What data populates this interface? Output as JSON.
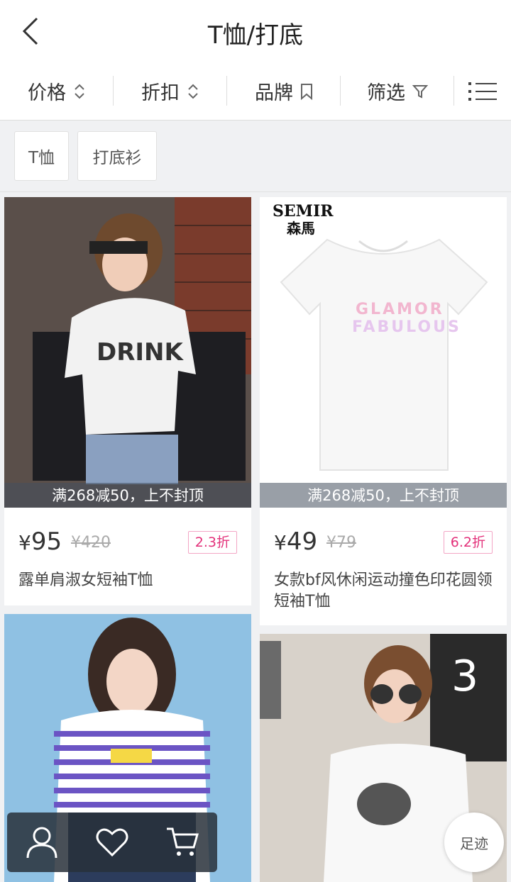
{
  "header": {
    "title": "T恤/打底"
  },
  "filters": [
    {
      "label": "价格",
      "icon": "sort-updown-icon"
    },
    {
      "label": "折扣",
      "icon": "sort-updown-icon"
    },
    {
      "label": "品牌",
      "icon": "bookmark-icon"
    },
    {
      "label": "筛选",
      "icon": "filter-funnel-icon"
    }
  ],
  "tags": [
    "T恤",
    "打底衫"
  ],
  "products": [
    {
      "promo": "满268减50，上不封顶",
      "currency": "¥",
      "price": "95",
      "old_price": "¥420",
      "discount": "2.3折",
      "name": "露单肩淑女短袖T恤"
    },
    {
      "brand_logo": "SEMIR 森馬",
      "promo": "满268减50，上不封顶",
      "currency": "¥",
      "price": "49",
      "old_price": "¥79",
      "discount": "6.2折",
      "name": "女款bf风休闲运动撞色印花圆领短袖T恤"
    },
    {
      "name": ""
    },
    {
      "name": ""
    }
  ],
  "bottom_bar": {
    "icons": [
      "user-icon",
      "heart-icon",
      "cart-icon"
    ]
  },
  "footprint_label": "足迹",
  "colors": {
    "accent": "#e3317a",
    "promo_bg": "#46505f"
  }
}
